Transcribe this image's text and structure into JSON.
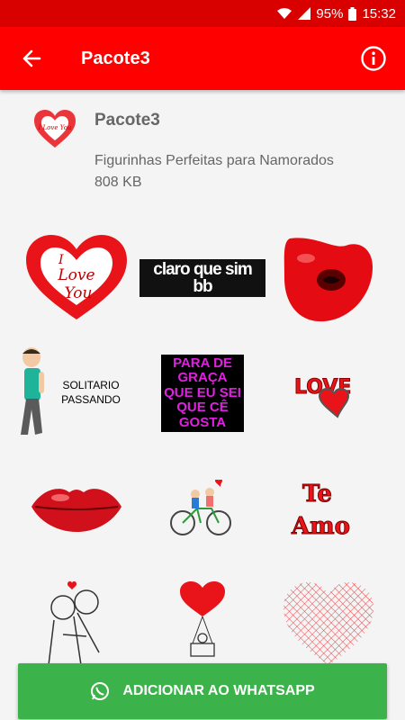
{
  "status": {
    "battery": "95%",
    "time": "15:32"
  },
  "app_bar": {
    "title": "Pacote3"
  },
  "pack": {
    "name": "Pacote3",
    "subtitle": "Figurinhas Perfeitas para Namorados",
    "size": "808 KB",
    "icon_text": "I Love You"
  },
  "stickers": {
    "s1_text1": "I",
    "s1_text2": "Love",
    "s1_text3": "You",
    "s2_text": "claro que sim bb",
    "s4_text": "SOLITARIO PASSANDO",
    "s5_text": "PARA DE GRAÇA QUE EU SEI QUE CÊ GOSTA",
    "s6_text": "LOVE",
    "s8_text1": "Te",
    "s8_text2": "Amo"
  },
  "button": {
    "label": "ADICIONAR AO WHATSAPP"
  },
  "colors": {
    "status_bar": "#d90000",
    "app_bar": "#ff0000",
    "button": "#3cb34a",
    "heart": "#e8141a"
  }
}
